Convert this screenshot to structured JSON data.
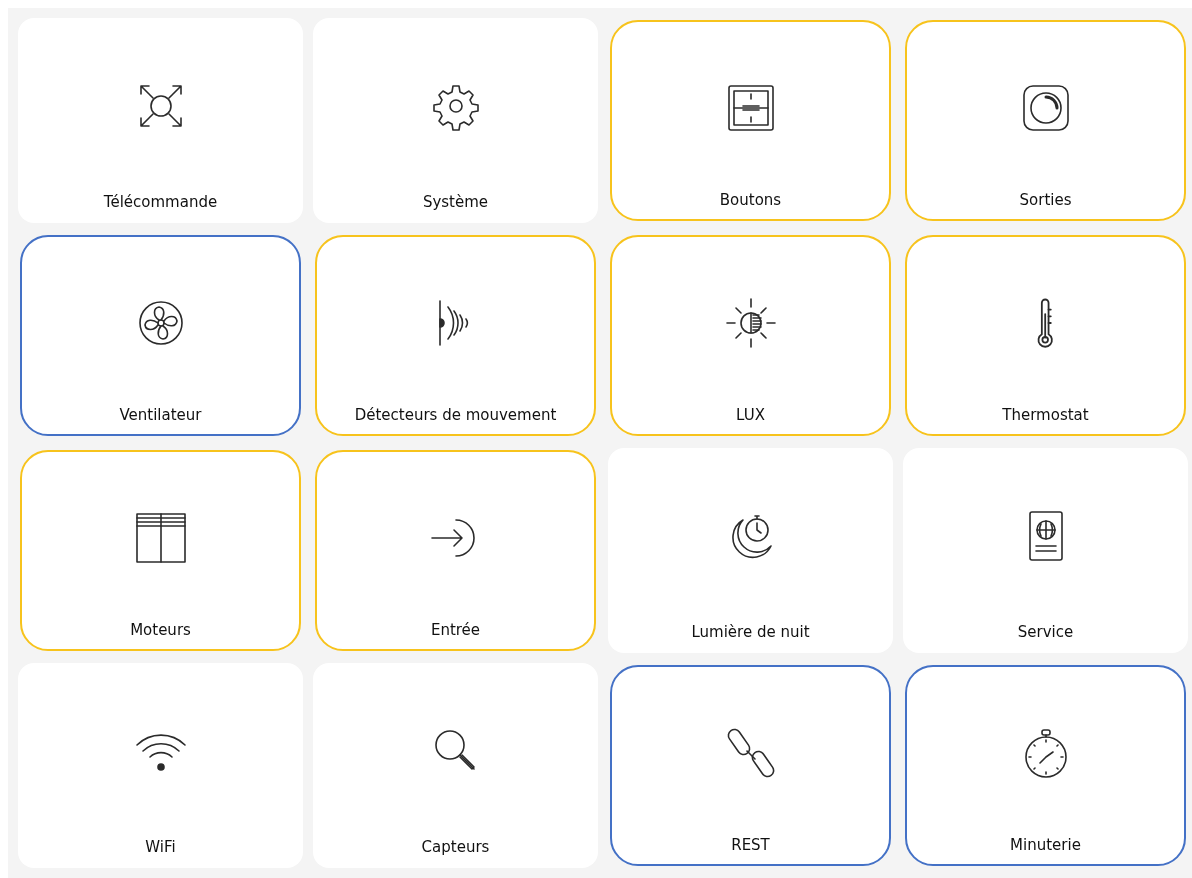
{
  "tiles": [
    {
      "label": "Télécommande",
      "kind": "remote"
    },
    {
      "label": "Système",
      "kind": "gear"
    },
    {
      "label": "Boutons",
      "kind": "buttons",
      "color": "#f7c31c"
    },
    {
      "label": "Sorties",
      "kind": "outputs",
      "color": "#f7c31c"
    },
    {
      "label": "Ventilateur",
      "kind": "fan",
      "color": "#4471c6"
    },
    {
      "label": "Détecteurs de mouvement",
      "kind": "motion",
      "color": "#f7c31c"
    },
    {
      "label": "LUX",
      "kind": "lux",
      "color": "#f7c31c"
    },
    {
      "label": "Thermostat",
      "kind": "thermo",
      "color": "#f7c31c"
    },
    {
      "label": "Moteurs",
      "kind": "blinds",
      "color": "#f7c31c"
    },
    {
      "label": "Entrée",
      "kind": "input",
      "color": "#f7c31c"
    },
    {
      "label": "Lumière de nuit",
      "kind": "night"
    },
    {
      "label": "Service",
      "kind": "passport"
    },
    {
      "label": "WiFi",
      "kind": "wifi"
    },
    {
      "label": "Capteurs",
      "kind": "search"
    },
    {
      "label": "REST",
      "kind": "link",
      "color": "#4471c6"
    },
    {
      "label": "Minuterie",
      "kind": "stopwatch",
      "color": "#4471c6"
    }
  ]
}
